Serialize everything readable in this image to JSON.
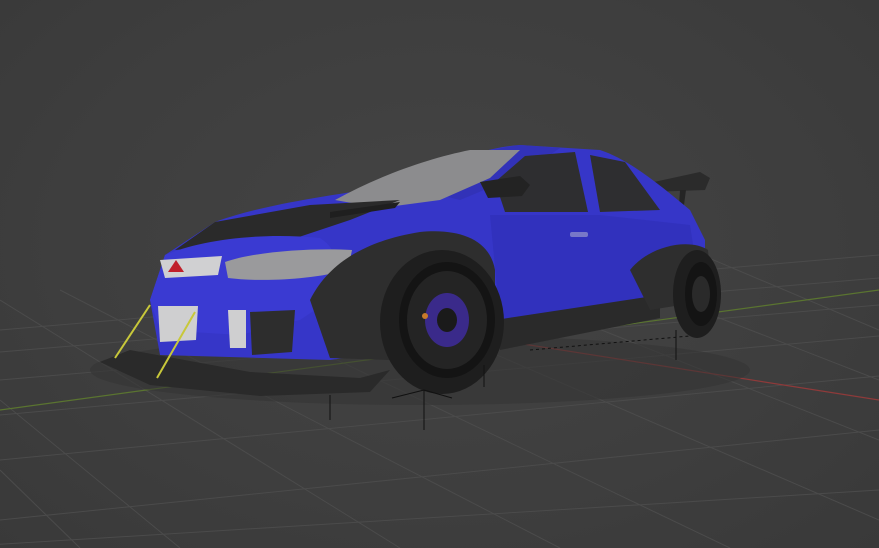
{
  "viewport": {
    "background_color": "#3d3d3d",
    "grid_color": "#4a4a4a",
    "x_axis_color": "#9a3a3a",
    "y_axis_color": "#5d7a2c"
  },
  "model": {
    "body_color": "#3a3ad0",
    "body_shadow_color": "#2a2aa0",
    "trim_color": "#2b2b2b",
    "glass_color": "#8a8a8c",
    "headlight_color": "#9c9c9e",
    "grille_color": "#d0d0d0",
    "tire_color": "#1e1e1e",
    "rim_color": "#141414",
    "caliper_color": "#3a2a8a",
    "strut_color": "#c8c83a",
    "badge_color": "#c0202a",
    "icon": "car-mesh-icon"
  },
  "overlays": {
    "empty_color": "#111111"
  }
}
